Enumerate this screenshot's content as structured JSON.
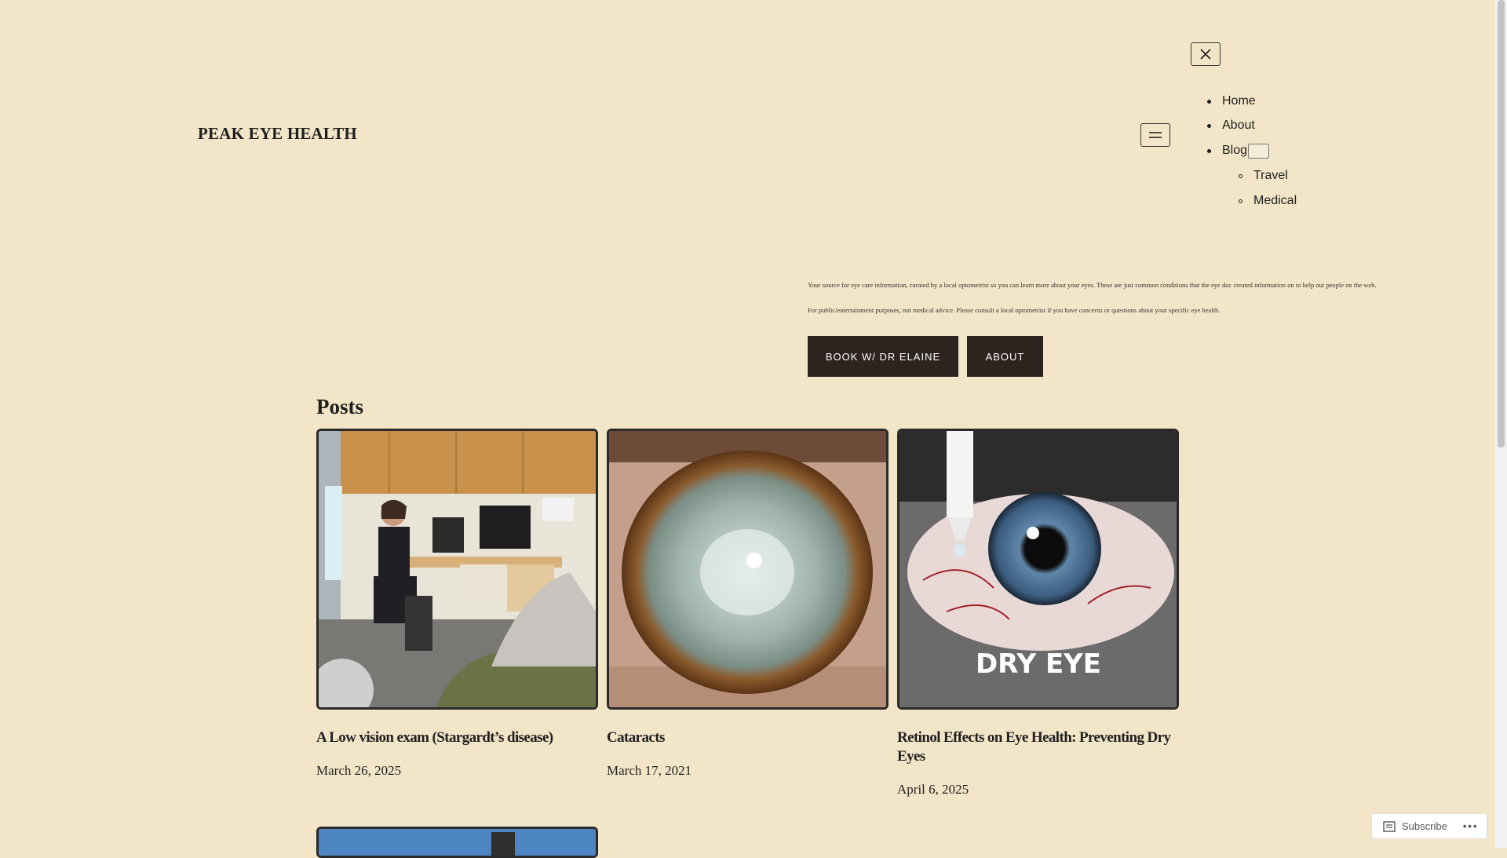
{
  "site": {
    "title": "PEAK EYE HEALTH"
  },
  "nav": {
    "items": [
      {
        "label": "Home"
      },
      {
        "label": "About"
      },
      {
        "label": "Blog"
      }
    ],
    "submenu": [
      {
        "label": "Travel"
      },
      {
        "label": "Medical"
      }
    ]
  },
  "intro": {
    "paragraph1": "Your source for eye care information, curated by a local optometrist so you can learn more about your eyes. These are just common conditions that the eye doc created information on to help out people on the web.",
    "paragraph2": "For public/entertainment purposes, not medical advice. Please consult a local optometrist if you have concerns or questions about your specific eye health."
  },
  "buttons": {
    "book": "BOOK W/ DR ELAINE",
    "about": "ABOUT"
  },
  "posts": {
    "heading": "Posts",
    "items": [
      {
        "title": "A Low vision exam (Stargardt’s disease)",
        "date": "March 26, 2025"
      },
      {
        "title": "Cataracts",
        "date": "March 17, 2021"
      },
      {
        "title": "Retinol Effects on Eye Health: Preventing Dry Eyes",
        "date": "April 6, 2025",
        "image_text": "DRY EYE"
      }
    ]
  },
  "subscribe": {
    "label": "Subscribe"
  },
  "colors": {
    "background": "#f3e6c8",
    "button": "#2d2420",
    "text": "#1f1f1f"
  }
}
